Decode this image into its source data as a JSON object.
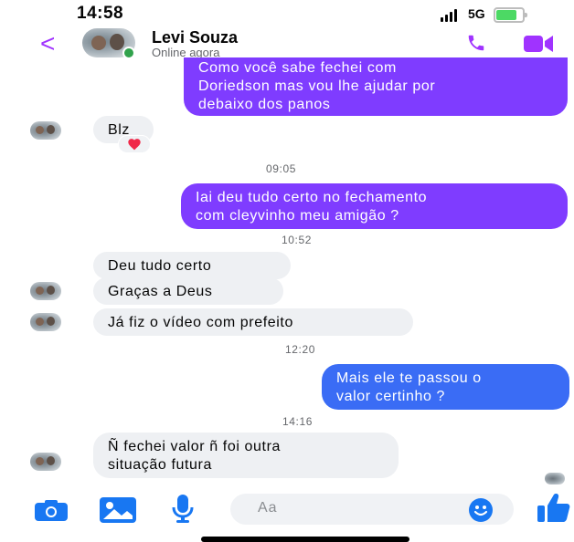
{
  "status_bar": {
    "time": "14:58",
    "network": "5G"
  },
  "header": {
    "back_label": "<",
    "contact_name": "Levi Souza",
    "contact_status": "Online agora"
  },
  "messages": [
    {
      "text": "Como você sabe fechei com\nDoriedson mas vou lhe ajudar por\ndebaixo dos panos"
    },
    {
      "text": "Blz",
      "reaction": "heart"
    },
    {
      "timestamp": "09:05"
    },
    {
      "text": "Iai deu tudo certo no fechamento\ncom cleyvinho meu amigão ?"
    },
    {
      "timestamp": "10:52"
    },
    {
      "text": "Deu tudo certo"
    },
    {
      "text": "Graças a Deus"
    },
    {
      "text": "Já fiz o vídeo com prefeito"
    },
    {
      "timestamp": "12:20"
    },
    {
      "text": "Mais ele te passou o\nvalor certinho ?"
    },
    {
      "timestamp": "14:16"
    },
    {
      "text": "Ñ fechei valor ñ foi outra\nsituação futura"
    }
  ],
  "composer": {
    "placeholder": "Aa"
  },
  "icons": {
    "call": "phone-icon",
    "video": "video-camera-icon",
    "camera": "camera-icon",
    "gallery": "image-icon",
    "mic": "microphone-icon",
    "emoji": "emoji-icon",
    "like": "thumbs-up-icon"
  },
  "colors": {
    "accent": "#a033ff",
    "outgoing_purple": "#7f3cff",
    "outgoing_blue": "#3a6cf5",
    "incoming": "#eef0f3",
    "composer_icons": "#1877f2",
    "online": "#31a24c"
  }
}
